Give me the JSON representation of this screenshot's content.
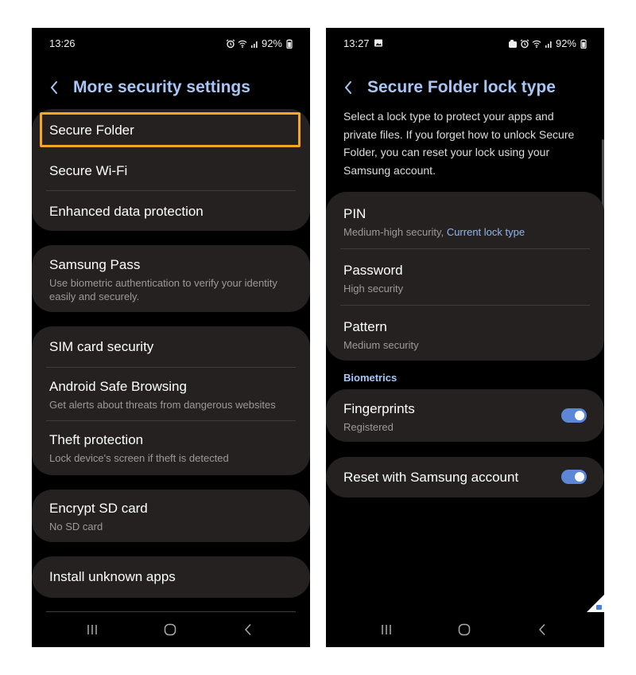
{
  "left_screen": {
    "status": {
      "time": "13:26",
      "battery": "92%"
    },
    "header": {
      "title": "More security settings"
    },
    "groups": [
      {
        "items": [
          {
            "label": "Secure Folder"
          },
          {
            "label": "Secure Wi-Fi"
          },
          {
            "label": "Enhanced data protection"
          }
        ]
      },
      {
        "items": [
          {
            "label": "Samsung Pass",
            "sub": "Use biometric authentication to verify your identity easily and securely."
          }
        ]
      },
      {
        "items": [
          {
            "label": "SIM card security"
          },
          {
            "label": "Android Safe Browsing",
            "sub": "Get alerts about threats from dangerous websites"
          },
          {
            "label": "Theft protection",
            "sub": "Lock device's screen if theft is detected"
          }
        ]
      },
      {
        "items": [
          {
            "label": "Encrypt SD card",
            "sub": "No SD card"
          }
        ]
      },
      {
        "items": [
          {
            "label": "Install unknown apps"
          }
        ]
      }
    ],
    "highlight_color": "#f5a623"
  },
  "right_screen": {
    "status": {
      "time": "13:27",
      "battery": "92%"
    },
    "header": {
      "title": "Secure Folder lock type"
    },
    "description": "Select a lock type to protect your apps and private files. If you forget how to unlock Secure Folder, you can reset your lock using your Samsung account.",
    "lock_types": [
      {
        "label": "PIN",
        "sub": "Medium-high security, ",
        "sub_accent": "Current lock type"
      },
      {
        "label": "Password",
        "sub": "High security"
      },
      {
        "label": "Pattern",
        "sub": "Medium security"
      }
    ],
    "biometrics_label": "Biometrics",
    "fingerprints": {
      "label": "Fingerprints",
      "sub": "Registered",
      "toggle_on": true
    },
    "reset": {
      "label": "Reset with Samsung account",
      "toggle_on": true
    }
  },
  "icons": [
    "alarm-icon",
    "wifi-icon",
    "signal-icon",
    "battery-icon",
    "image-icon",
    "back-arrow-icon",
    "recent-apps-icon",
    "home-icon",
    "nav-back-icon"
  ],
  "colors": {
    "accent": "#a8c6f5",
    "card": "#242120",
    "toggle": "#5b87d6"
  }
}
